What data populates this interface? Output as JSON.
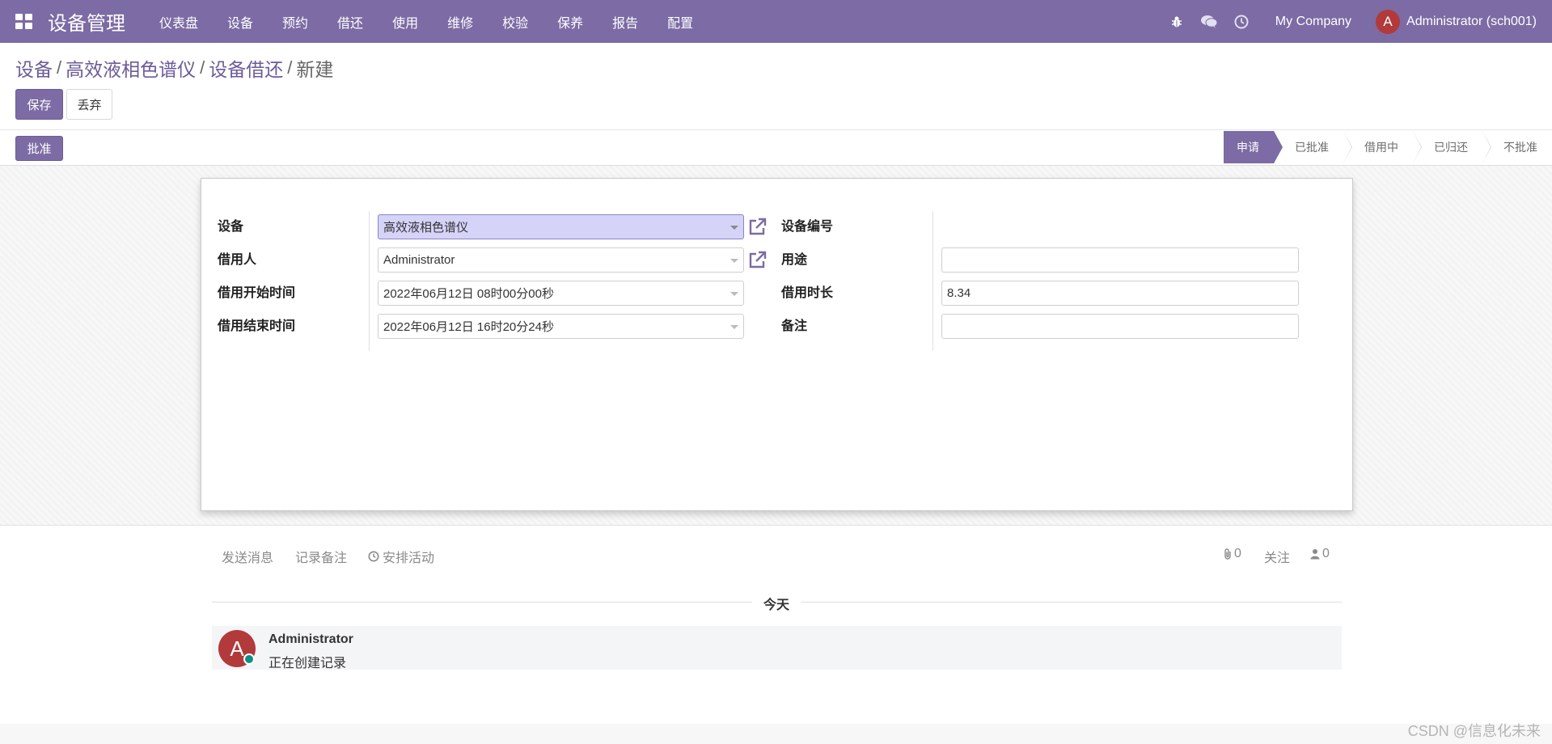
{
  "navbar": {
    "brand": "设备管理",
    "menu": [
      "仪表盘",
      "设备",
      "预约",
      "借还",
      "使用",
      "维修",
      "校验",
      "保养",
      "报告",
      "配置"
    ],
    "company": "My Company",
    "user_initial": "A",
    "user_name": "Administrator (sch001)",
    "color": "#7c6ba4"
  },
  "breadcrumb": {
    "items": [
      "设备",
      "高效液相色谱仪",
      "设备借还"
    ],
    "current": "新建",
    "separator": "/"
  },
  "actions": {
    "save": "保存",
    "discard": "丢弃",
    "approve": "批准"
  },
  "statusbar": {
    "stages": [
      "申请",
      "已批准",
      "借用中",
      "已归还",
      "不批准"
    ],
    "active": "申请"
  },
  "form": {
    "left": [
      {
        "label": "设备",
        "value": "高效液相色谱仪"
      },
      {
        "label": "借用人",
        "value": "Administrator"
      },
      {
        "label": "借用开始时间",
        "value": "2022年06月12日 08时00分00秒"
      },
      {
        "label": "借用结束时间",
        "value": "2022年06月12日 16时20分24秒"
      }
    ],
    "right": [
      {
        "label": "设备编号",
        "value": ""
      },
      {
        "label": "用途",
        "value": ""
      },
      {
        "label": "借用时长",
        "value": "8.34"
      },
      {
        "label": "备注",
        "value": ""
      }
    ]
  },
  "chatter": {
    "send_message": "发送消息",
    "log_note": "记录备注",
    "schedule_activity": "安排活动",
    "attachments": "0",
    "follow": "关注",
    "followers": "0",
    "date_separator": "今天",
    "message": {
      "author_initial": "A",
      "author": "Administrator",
      "body": "正在创建记录"
    }
  },
  "watermark": "CSDN @信息化未来"
}
